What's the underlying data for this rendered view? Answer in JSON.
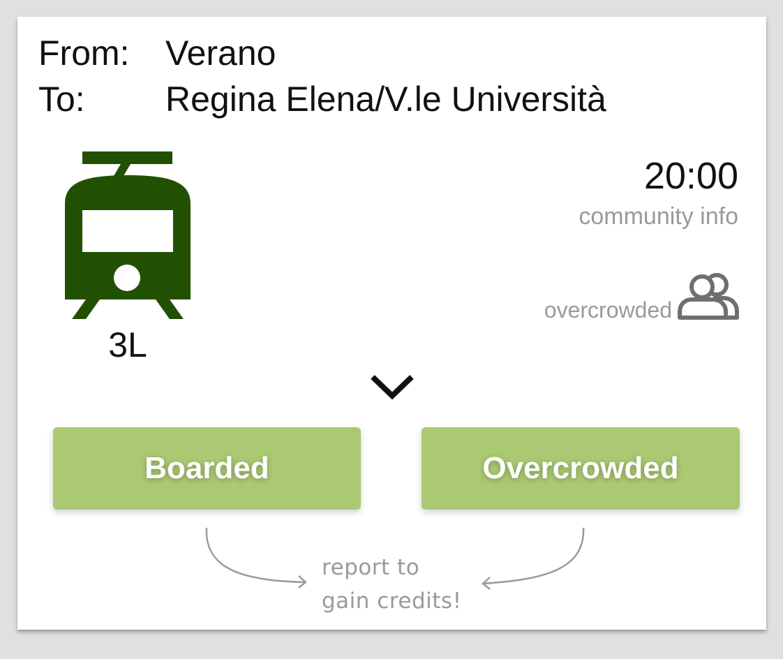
{
  "route": {
    "from_label": "From:",
    "from_value": "Verano",
    "to_label": "To:",
    "to_value": "Regina Elena/V.le Università"
  },
  "vehicle": {
    "icon": "tram-icon",
    "line": "3L",
    "icon_color": "#215003"
  },
  "departure": {
    "time": "20:00",
    "source": "community info"
  },
  "crowding": {
    "status": "overcrowded",
    "icon": "people-icon"
  },
  "actions": {
    "boarded_label": "Boarded",
    "overcrowded_label": "Overcrowded",
    "button_color": "#abc972"
  },
  "hint": {
    "line1": "report to",
    "line2": "gain credits!"
  }
}
